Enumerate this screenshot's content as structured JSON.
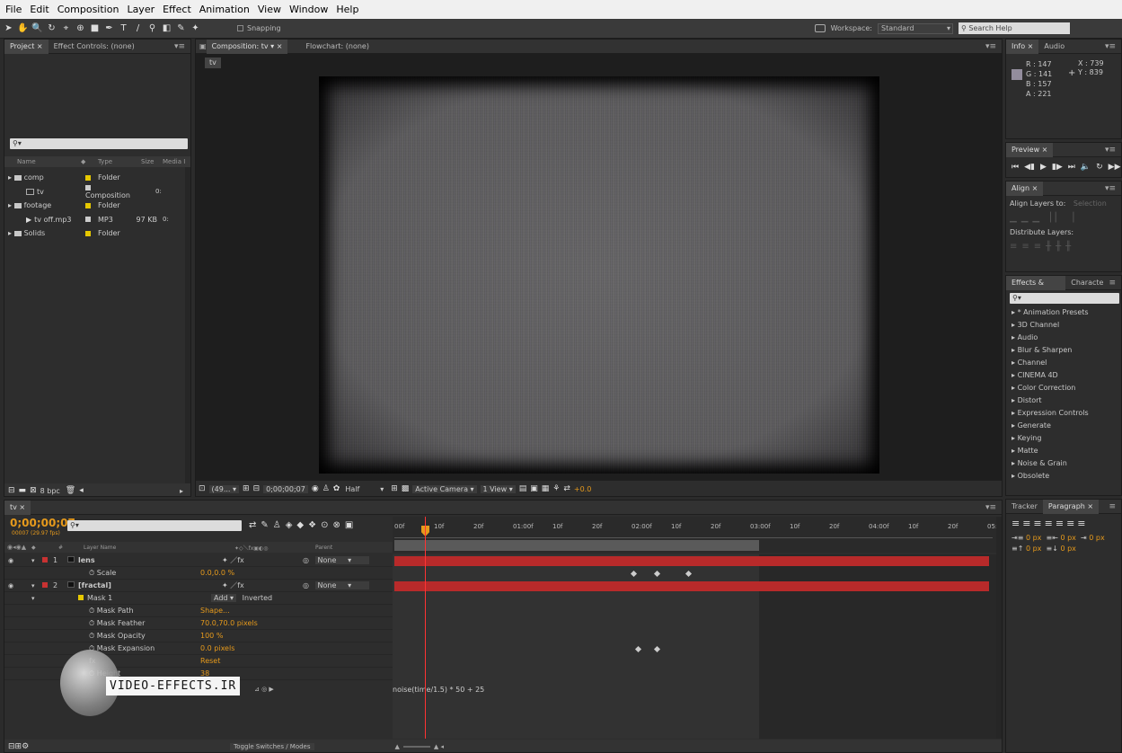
{
  "menu": [
    "File",
    "Edit",
    "Composition",
    "Layer",
    "Effect",
    "Animation",
    "View",
    "Window",
    "Help"
  ],
  "toolbar": {
    "snapping_label": "Snapping",
    "workspace_label": "Workspace:",
    "workspace_value": "Standard",
    "search_placeholder": "Search Help"
  },
  "project_panel": {
    "tabs": [
      "Project",
      "Effect Controls: (none)"
    ],
    "columns": [
      "Name",
      "Type",
      "Size",
      "Media I"
    ],
    "search": "",
    "items": [
      {
        "name": "comp",
        "type": "Folder",
        "size": "",
        "kind": "folder",
        "indent": 0
      },
      {
        "name": "tv",
        "type": "Composition",
        "size": "",
        "kind": "comp",
        "indent": 1
      },
      {
        "name": "footage",
        "type": "Folder",
        "size": "",
        "kind": "folder",
        "indent": 0
      },
      {
        "name": "tv off.mp3",
        "type": "MP3",
        "size": "97 KB",
        "kind": "audio",
        "indent": 1
      },
      {
        "name": "Solids",
        "type": "Folder",
        "size": "",
        "kind": "folder",
        "indent": 0
      }
    ],
    "bpc": "8 bpc"
  },
  "composition_panel": {
    "tabs": [
      "Composition: tv",
      "Flowchart: (none)"
    ],
    "breadcrumb": "tv",
    "zoom": "(49...",
    "timecode": "0;00;00;07",
    "resolution": "Half",
    "camera": "Active Camera",
    "view": "1 View",
    "exposure": "+0.0"
  },
  "info_panel": {
    "tabs": [
      "Info",
      "Audio"
    ],
    "r": "R : 147",
    "g": "G : 141",
    "b": "B : 157",
    "a": "A : 221",
    "x": "X : 739",
    "y": "Y : 839",
    "swatch": "#938d9d"
  },
  "preview_panel": {
    "tab": "Preview"
  },
  "align_panel": {
    "tab": "Align",
    "align_to_label": "Align Layers to:",
    "align_to_value": "Selection",
    "distribute_label": "Distribute Layers:"
  },
  "effects_panel": {
    "tabs": [
      "Effects & Presets",
      "Characte"
    ],
    "search": "",
    "items": [
      "* Animation Presets",
      "3D Channel",
      "Audio",
      "Blur & Sharpen",
      "Channel",
      "CINEMA 4D",
      "Color Correction",
      "Distort",
      "Expression Controls",
      "Generate",
      "Keying",
      "Matte",
      "Noise & Grain",
      "Obsolete"
    ]
  },
  "paragraph_panel": {
    "tabs": [
      "Tracker",
      "Paragraph"
    ],
    "indent_left": "0 px",
    "indent_right": "0 px",
    "first_line": "0 px",
    "space_before": "0 px",
    "space_after": "0 px"
  },
  "timeline": {
    "tab": "tv",
    "timecode": "0;00;00;07",
    "frame_info": "00007 (29.97 fps)",
    "columns": {
      "num": "#",
      "layer_name": "Layer Name",
      "parent": "Parent"
    },
    "ruler": [
      "00f",
      "10f",
      "20f",
      "01:00f",
      "10f",
      "20f",
      "02:00f",
      "10f",
      "20f",
      "03:00f",
      "10f",
      "20f",
      "04:00f",
      "10f",
      "20f",
      "05:0"
    ],
    "rows": [
      {
        "num": "1",
        "name": "lens",
        "type": "layer",
        "parent": "None"
      },
      {
        "num": "",
        "name": "Scale",
        "type": "prop",
        "value": "0.0,0.0 %"
      },
      {
        "num": "2",
        "name": "[fractal]",
        "type": "layer",
        "parent": "None"
      },
      {
        "num": "",
        "name": "Mask 1",
        "type": "mask",
        "mode": "Add",
        "inverted": "Inverted"
      },
      {
        "num": "",
        "name": "Mask Path",
        "type": "prop",
        "value": "Shape..."
      },
      {
        "num": "",
        "name": "Mask Feather",
        "type": "prop",
        "value": "70.0,70.0 pixels"
      },
      {
        "num": "",
        "name": "Mask Opacity",
        "type": "prop",
        "value": "100 %"
      },
      {
        "num": "",
        "name": "Mask Expansion",
        "type": "prop",
        "value": "0.0 pixels"
      },
      {
        "num": "",
        "name": "",
        "type": "fx",
        "value": "Reset"
      },
      {
        "num": "",
        "name": "Height",
        "type": "prop",
        "value": "38"
      }
    ],
    "expression": "noise(time/1.5) * 50 + 25",
    "toggle_label": "Toggle Switches / Modes"
  },
  "watermark": "VIDEO-EFFECTS.IR",
  "colors": {
    "accent": "#e69a1c",
    "layer_bar": "#b82a2a",
    "label_red": "#c83232",
    "label_yellow": "#e6c800",
    "cti": "#ff3333"
  }
}
